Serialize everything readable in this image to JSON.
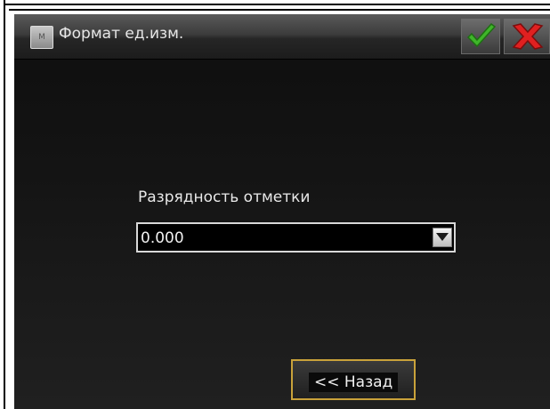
{
  "title_bar": {
    "icon_text": "M",
    "title": "Формат ед.изм.",
    "ok_icon": "check-icon",
    "cancel_icon": "close-icon",
    "ok_color": "#3fb52a",
    "cancel_color": "#e02020"
  },
  "form": {
    "label": "Разрядность отметки",
    "selected_value": "0.000",
    "dropdown_icon": "chevron-down-icon"
  },
  "footer": {
    "back_label": "<< Назад",
    "accent": "#c9a23a"
  }
}
